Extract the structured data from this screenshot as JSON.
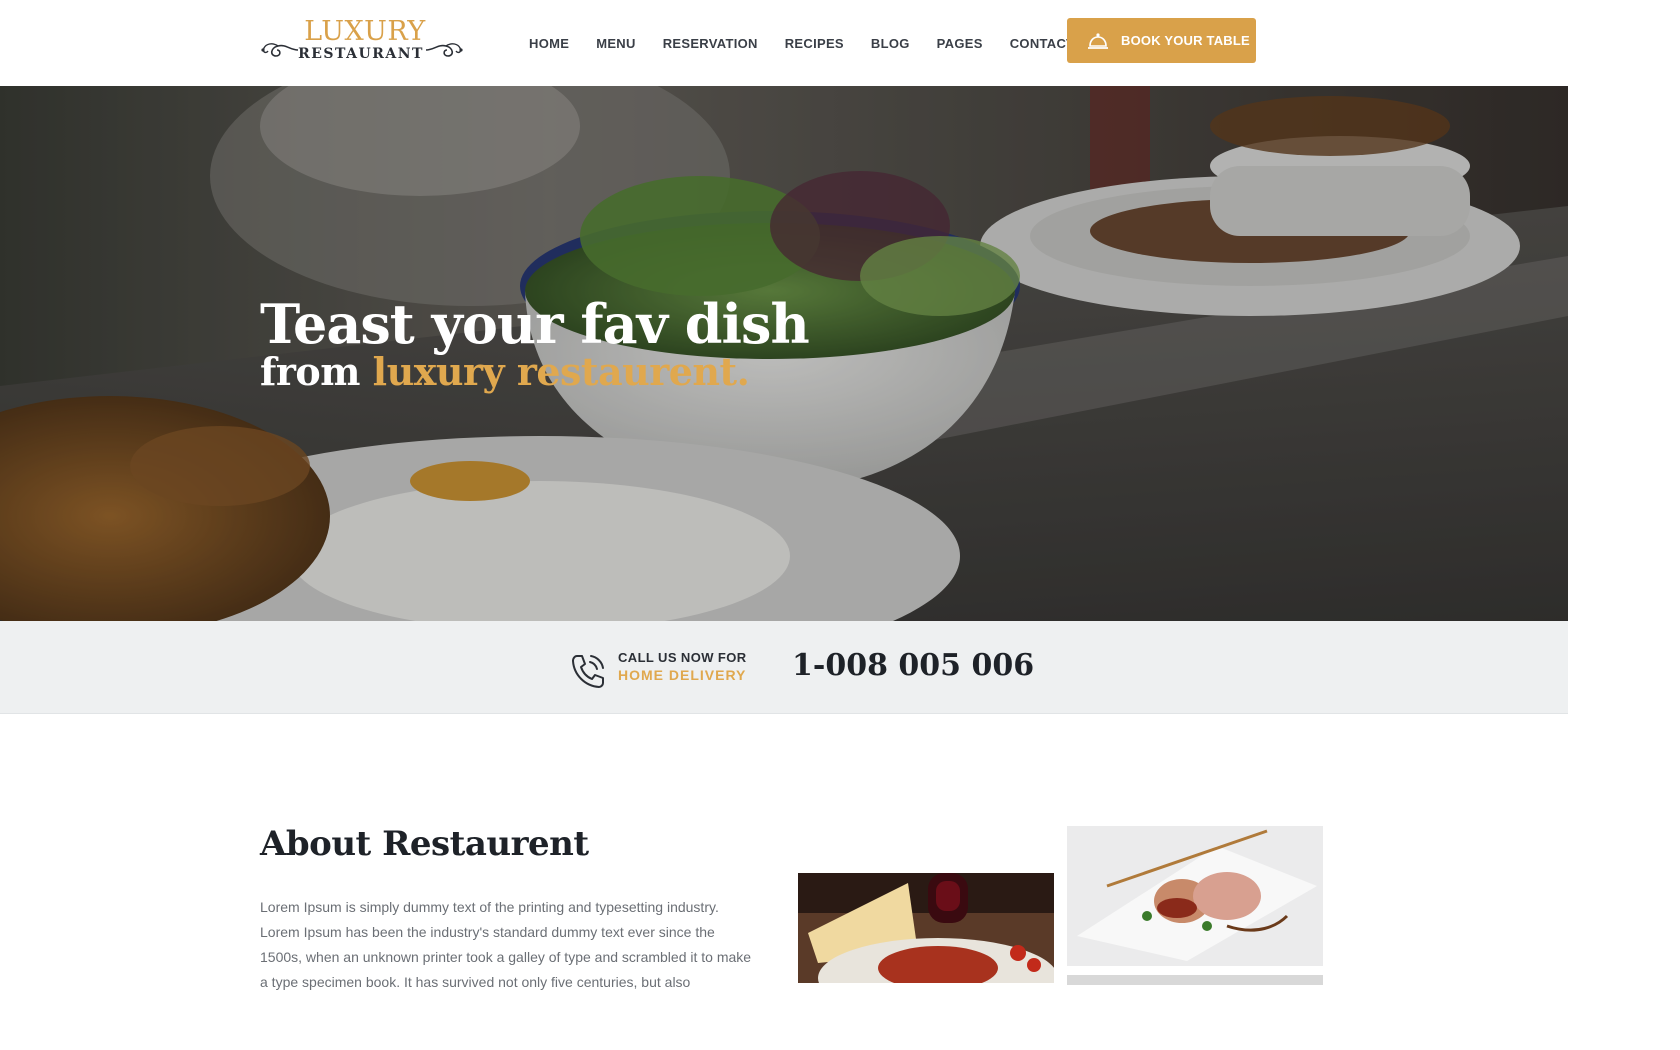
{
  "brand": {
    "logo_top": "LUXURY",
    "logo_bottom": "RESTAURANT",
    "accent_color": "#d9a14a",
    "dark_color": "#2b2f36"
  },
  "nav": {
    "items": [
      "HOME",
      "MENU",
      "RESERVATION",
      "RECIPES",
      "BLOG",
      "PAGES",
      "CONTACT"
    ]
  },
  "book_button": {
    "label": "BOOK YOUR TABLE",
    "icon": "service-bell-icon"
  },
  "hero": {
    "title": "Teast your fav dish",
    "sub_prefix": "from ",
    "sub_accent": "luxury restaurent."
  },
  "callbar": {
    "icon": "phone-icon",
    "line1": "CALL US NOW FOR",
    "line2": "HOME DELIVERY",
    "number": "1-008 005 006"
  },
  "about": {
    "title": "About Restaurent",
    "text": "Lorem Ipsum is simply dummy text of the printing and typesetting industry. Lorem Ipsum has been the industry's standard dummy text ever since the 1500s, when an unknown printer took a galley of type and scrambled it to make a type specimen book. It has survived not only five centuries, but also"
  }
}
